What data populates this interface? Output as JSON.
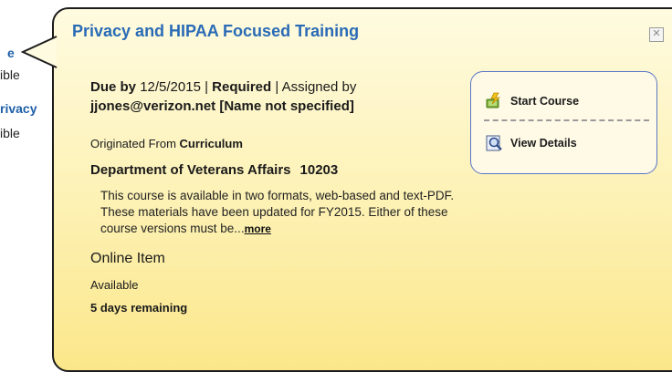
{
  "background": {
    "fragments": [
      {
        "text": "e",
        "kind": "link"
      },
      {
        "text": "ible",
        "kind": "text"
      },
      {
        "text": "rivacy",
        "kind": "link"
      },
      {
        "text": "ible",
        "kind": "text"
      }
    ]
  },
  "popup": {
    "title": "Privacy and HIPAA Focused Training",
    "close_icon": "close-icon",
    "due": {
      "due_label": "Due by",
      "due_date": "12/5/2015",
      "sep1": "|",
      "required_label": "Required",
      "sep2": "|",
      "assigned_label": "Assigned by",
      "assigned_by": "jjones@verizon.net [Name not specified]"
    },
    "origin": {
      "label": "Originated From",
      "value": "Curriculum"
    },
    "department": {
      "name": "Department of Veterans Affairs",
      "code": "10203"
    },
    "description": "This course is available in two formats, web-based and text-PDF. These materials have been updated for FY2015. Either of these course versions must be...",
    "more_label": "more",
    "online_item": "Online Item",
    "availability": "Available",
    "remaining": "5 days remaining",
    "actions": {
      "start_label": "Start Course",
      "start_icon": "start-course-icon",
      "view_label": "View Details",
      "view_icon": "magnifier-icon"
    }
  },
  "colors": {
    "title": "#2a6bb6",
    "popup_top": "#fefbe0",
    "popup_bottom": "#fbe78a",
    "action_border": "#5a76c6"
  }
}
